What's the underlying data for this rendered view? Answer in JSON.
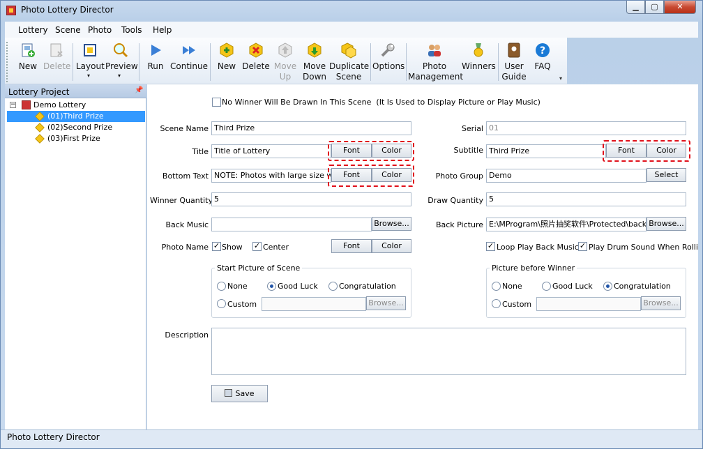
{
  "window": {
    "title": "Photo Lottery Director",
    "minimize": "▁",
    "maximize": "▢",
    "close": "✕"
  },
  "menu": [
    "Lottery",
    "Scene",
    "Photo",
    "Tools",
    "Help"
  ],
  "toolbar": {
    "new1": "New",
    "delete1": "Delete",
    "layout": "Layout",
    "preview": "Preview",
    "run": "Run",
    "continue": "Continue",
    "new2": "New",
    "delete2": "Delete",
    "move_up_1": "Move",
    "move_up_2": "Up",
    "move_down_1": "Move",
    "move_down_2": "Down",
    "duplicate_1": "Duplicate",
    "duplicate_2": "Scene",
    "options": "Options",
    "photo_mgmt_1": "Photo",
    "photo_mgmt_2": "Management",
    "winners": "Winners",
    "user_guide_1": "User",
    "user_guide_2": "Guide",
    "faq": "FAQ"
  },
  "panel": {
    "title": "Lottery Project",
    "root": "Demo Lottery",
    "items": [
      "(01)Third Prize",
      "(02)Second Prize",
      "(03)First Prize"
    ]
  },
  "form": {
    "no_winner": "No Winner Will Be Drawn In This Scene  (It Is Used to Display Picture or Play Music)",
    "scene_name_label": "Scene Name",
    "scene_name": "Third Prize",
    "serial_label": "Serial",
    "serial": "01",
    "title_label": "Title",
    "title": "Title of Lottery",
    "subtitle_label": "Subtitle",
    "subtitle": "Third Prize",
    "font": "Font",
    "color": "Color",
    "bottom_text_label": "Bottom Text",
    "bottom_text": "NOTE: Photos with large size will m",
    "photo_group_label": "Photo Group",
    "photo_group": "Demo",
    "select": "Select",
    "winner_qty_label": "Winner Quantity",
    "winner_qty": "5",
    "draw_qty_label": "Draw Quantity",
    "draw_qty": "5",
    "back_music_label": "Back Music",
    "back_music": "",
    "browse": "Browse...",
    "back_picture_label": "Back Picture",
    "back_picture": "E:\\MProgram\\照片抽奖软件\\Protected\\back.jp",
    "photo_name_label": "Photo Name",
    "show": "Show",
    "center": "Center",
    "loop_music": "Loop Play Back Music",
    "drum_sound": "Play Drum Sound When Rolling P",
    "start_picture_title": "Start Picture of Scene",
    "picture_before_title": "Picture before Winner",
    "none": "None",
    "good_luck": "Good Luck",
    "congratulation": "Congratulation",
    "custom": "Custom",
    "description_label": "Description",
    "description": "",
    "save": "Save"
  },
  "status": "Photo Lottery Director"
}
